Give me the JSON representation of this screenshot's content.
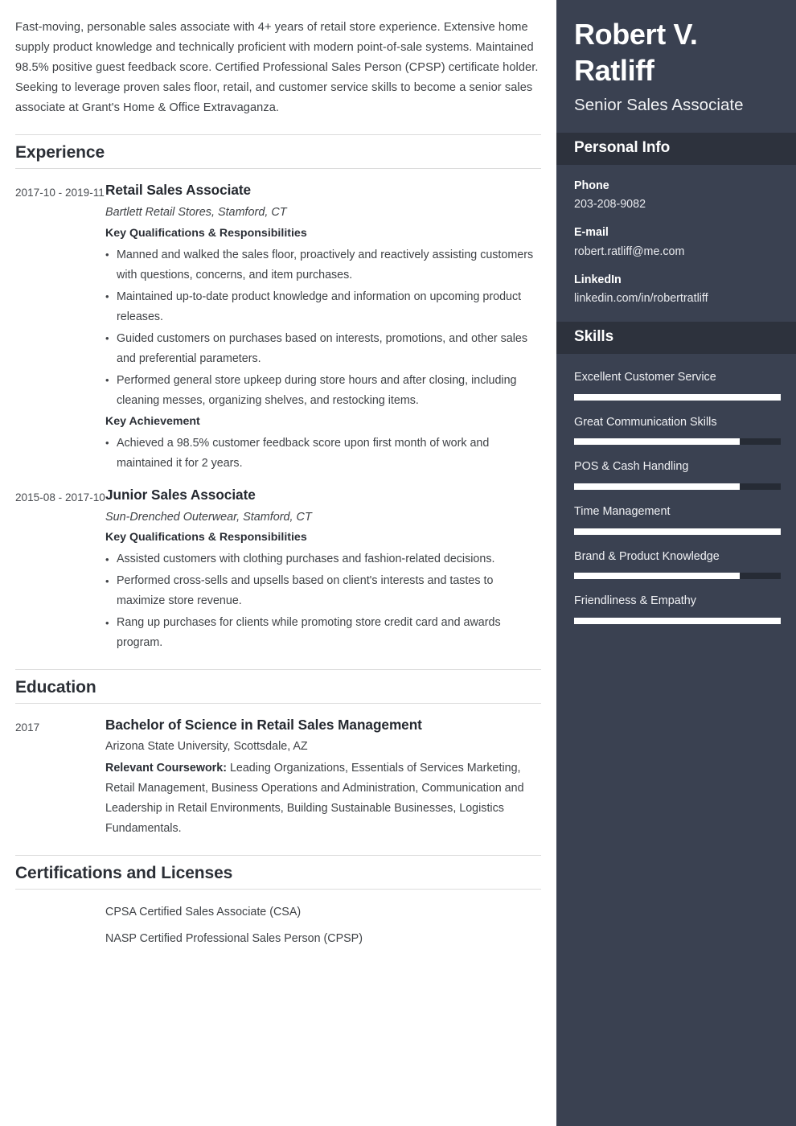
{
  "colors": {
    "sidebar_bg": "#3a4151",
    "sidebar_band_bg": "#2d323d",
    "skill_track": "#262b35",
    "skill_fill": "#ffffff",
    "heading_text": "#2b2f36",
    "body_text": "#3f4246",
    "rule": "#dcdcdc"
  },
  "summary": "Fast-moving, personable sales associate with 4+ years of retail store experience. Extensive home supply product knowledge and technically proficient with modern point-of-sale systems. Maintained 98.5% positive guest feedback score. Certified Professional Sales Person (CPSP) certificate holder. Seeking to leverage proven sales floor, retail, and customer service skills to become a senior sales associate at Grant's Home & Office Extravaganza.",
  "sections": {
    "experience_title": "Experience",
    "education_title": "Education",
    "certifications_title": "Certifications and Licenses"
  },
  "experience": [
    {
      "dates": "2017-10 - 2019-11",
      "title": "Retail Sales Associate",
      "organization": "Bartlett Retail Stores, Stamford, CT",
      "qualifications_label": "Key Qualifications & Responsibilities",
      "bullets": [
        "Manned and walked the sales floor, proactively and reactively assisting customers with questions, concerns, and item purchases.",
        "Maintained up-to-date product knowledge and information on upcoming product releases.",
        "Guided customers on purchases based on interests, promotions, and other sales and preferential parameters.",
        "Performed general store upkeep during store hours and after closing, including cleaning messes, organizing shelves, and restocking items."
      ],
      "achievement_label": "Key Achievement",
      "achievements": [
        "Achieved a 98.5% customer feedback score upon first month of work and maintained it for 2 years."
      ]
    },
    {
      "dates": "2015-08 - 2017-10",
      "title": "Junior Sales Associate",
      "organization": "Sun-Drenched Outerwear, Stamford, CT",
      "qualifications_label": "Key Qualifications & Responsibilities",
      "bullets": [
        "Assisted customers with clothing purchases and fashion-related decisions.",
        "Performed cross-sells and upsells based on client's interests and tastes to maximize store revenue.",
        "Rang up purchases for clients while promoting store credit card and awards program."
      ]
    }
  ],
  "education": [
    {
      "dates": "2017",
      "degree": "Bachelor of Science in Retail Sales Management",
      "school": "Arizona State University, Scottsdale, AZ",
      "coursework_label": "Relevant Coursework:",
      "coursework": "Leading Organizations, Essentials of Services Marketing, Retail Management, Business Operations and Administration, Communication and Leadership in Retail Environments, Building Sustainable Businesses, Logistics Fundamentals."
    }
  ],
  "certifications": [
    "CPSA Certified Sales Associate (CSA)",
    "NASP Certified Professional Sales Person (CPSP)"
  ],
  "sidebar": {
    "name": "Robert V. Ratliff",
    "role": "Senior Sales Associate",
    "personal_info_title": "Personal Info",
    "contacts": [
      {
        "label": "Phone",
        "value": "203-208-9082"
      },
      {
        "label": "E-mail",
        "value": "robert.ratliff@me.com"
      },
      {
        "label": "LinkedIn",
        "value": "linkedin.com/in/robertratliff"
      }
    ],
    "skills_title": "Skills",
    "skills": [
      {
        "name": "Excellent Customer Service",
        "level": 100
      },
      {
        "name": "Great Communication Skills",
        "level": 80
      },
      {
        "name": "POS & Cash Handling",
        "level": 80
      },
      {
        "name": "Time Management",
        "level": 100
      },
      {
        "name": "Brand & Product Knowledge",
        "level": 80
      },
      {
        "name": "Friendliness & Empathy",
        "level": 100
      }
    ]
  }
}
